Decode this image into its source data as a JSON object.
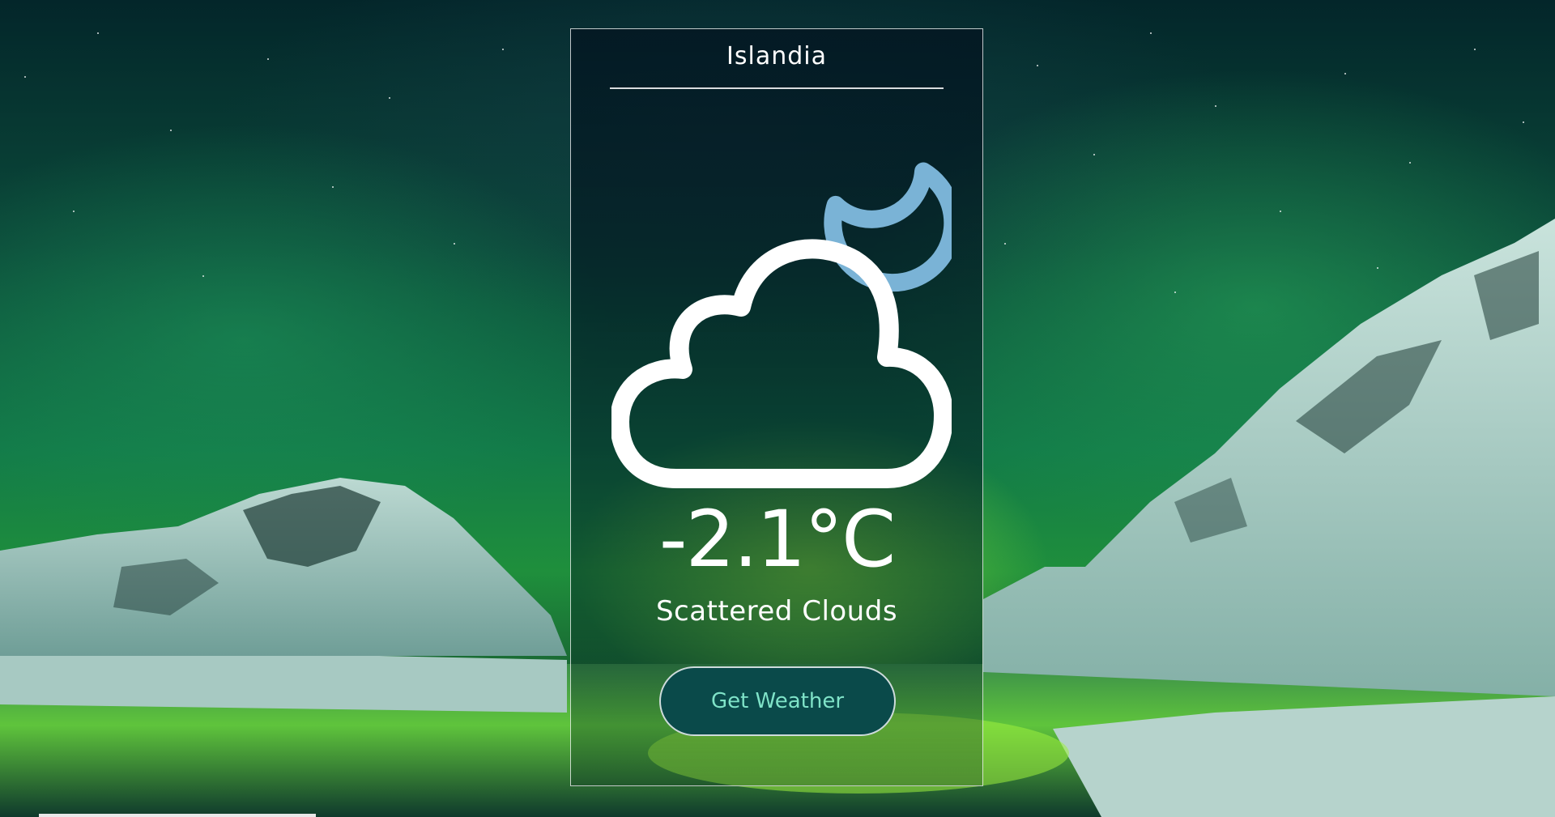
{
  "city": "Islandia",
  "temperature": "-2.1°C",
  "description": "Scattered Clouds",
  "button_label": "Get Weather",
  "weather_icon": "cloud-moon-icon",
  "colors": {
    "moon": "#7ab3d6",
    "cloud": "#ffffff",
    "button_bg": "#0a4a4a",
    "button_text": "#7fe3c8"
  }
}
